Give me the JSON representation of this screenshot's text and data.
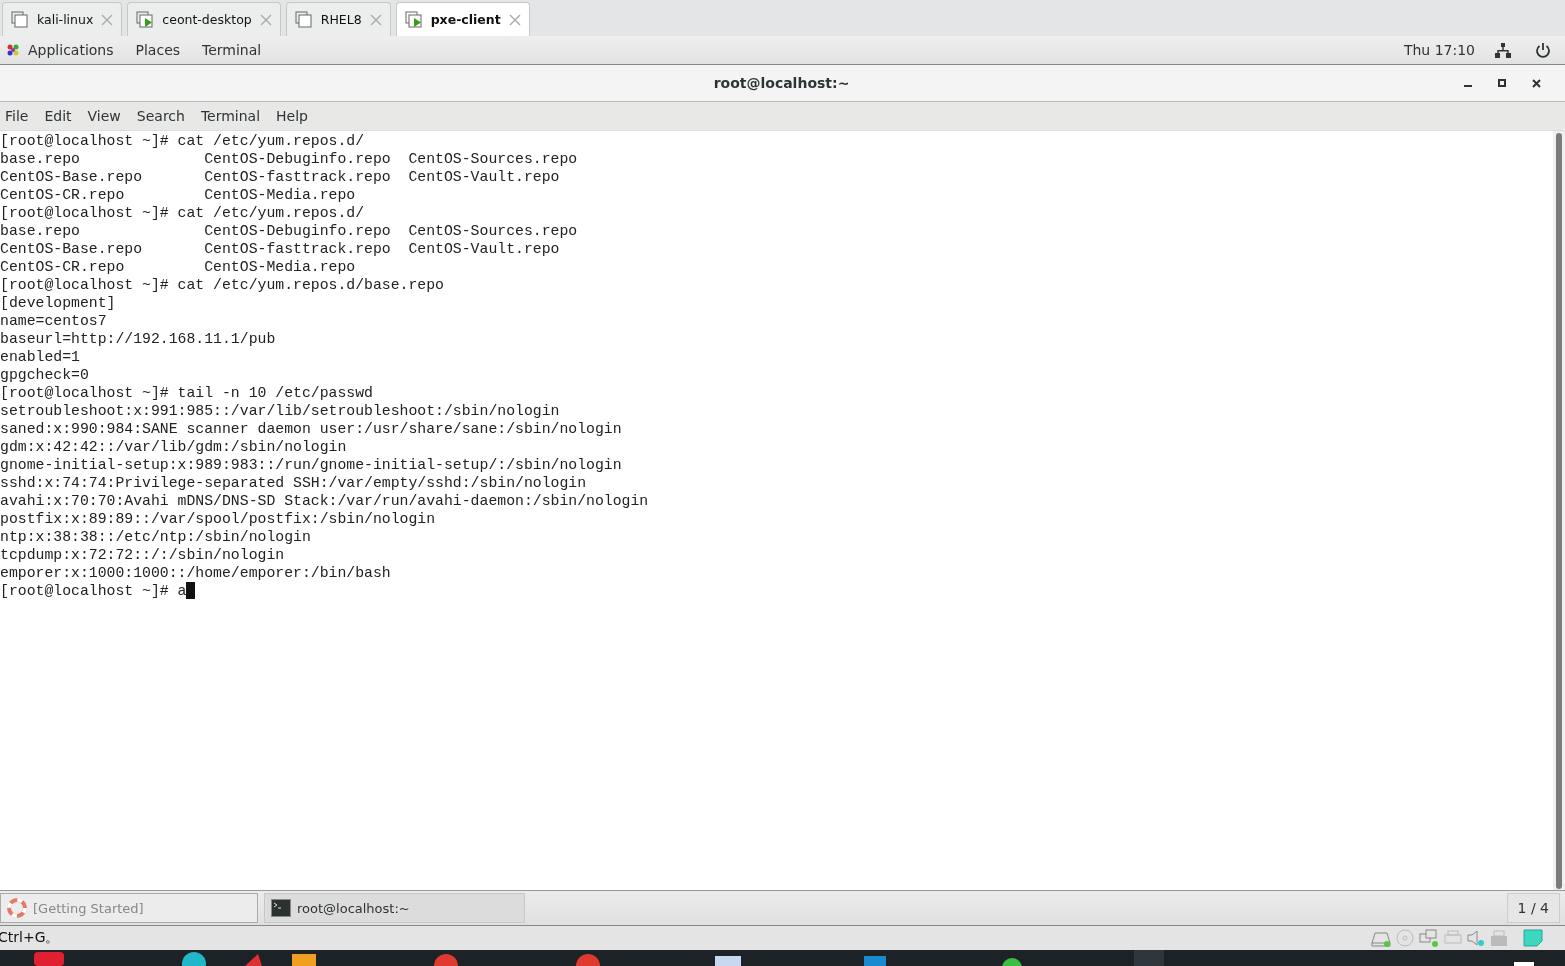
{
  "host_tabs": [
    {
      "label": "kali-linux",
      "selected": false,
      "running": false
    },
    {
      "label": "ceont-desktop",
      "selected": false,
      "running": true
    },
    {
      "label": "RHEL8",
      "selected": false,
      "running": false
    },
    {
      "label": "pxe-client",
      "selected": true,
      "running": true
    }
  ],
  "top_bar": {
    "menus": [
      "Applications",
      "Places",
      "Terminal"
    ],
    "clock": "Thu 17:10"
  },
  "window": {
    "title": "root@localhost:~"
  },
  "menu": [
    "File",
    "Edit",
    "View",
    "Search",
    "Terminal",
    "Help"
  ],
  "terminal": {
    "lines": [
      "[root@localhost ~]# cat /etc/yum.repos.d/",
      "base.repo              CentOS-Debuginfo.repo  CentOS-Sources.repo",
      "CentOS-Base.repo       CentOS-fasttrack.repo  CentOS-Vault.repo",
      "CentOS-CR.repo         CentOS-Media.repo",
      "[root@localhost ~]# cat /etc/yum.repos.d/",
      "base.repo              CentOS-Debuginfo.repo  CentOS-Sources.repo",
      "CentOS-Base.repo       CentOS-fasttrack.repo  CentOS-Vault.repo",
      "CentOS-CR.repo         CentOS-Media.repo",
      "[root@localhost ~]# cat /etc/yum.repos.d/base.repo",
      "[development]",
      "name=centos7",
      "baseurl=http://192.168.11.1/pub",
      "enabled=1",
      "gpgcheck=0",
      "[root@localhost ~]# tail -n 10 /etc/passwd",
      "setroubleshoot:x:991:985::/var/lib/setroubleshoot:/sbin/nologin",
      "saned:x:990:984:SANE scanner daemon user:/usr/share/sane:/sbin/nologin",
      "gdm:x:42:42::/var/lib/gdm:/sbin/nologin",
      "gnome-initial-setup:x:989:983::/run/gnome-initial-setup/:/sbin/nologin",
      "sshd:x:74:74:Privilege-separated SSH:/var/empty/sshd:/sbin/nologin",
      "avahi:x:70:70:Avahi mDNS/DNS-SD Stack:/var/run/avahi-daemon:/sbin/nologin",
      "postfix:x:89:89::/var/spool/postfix:/sbin/nologin",
      "ntp:x:38:38::/etc/ntp:/sbin/nologin",
      "tcpdump:x:72:72::/:/sbin/nologin",
      "emporer:x:1000:1000::/home/emporer:/bin/bash"
    ],
    "prompt": "[root@localhost ~]# a"
  },
  "window_list": [
    {
      "label": "[Getting Started]",
      "selected": false,
      "kind": "help"
    },
    {
      "label": "root@localhost:~",
      "selected": true,
      "kind": "terminal"
    }
  ],
  "workspace": "1 / 4",
  "status_text": "Ctrl+G。"
}
